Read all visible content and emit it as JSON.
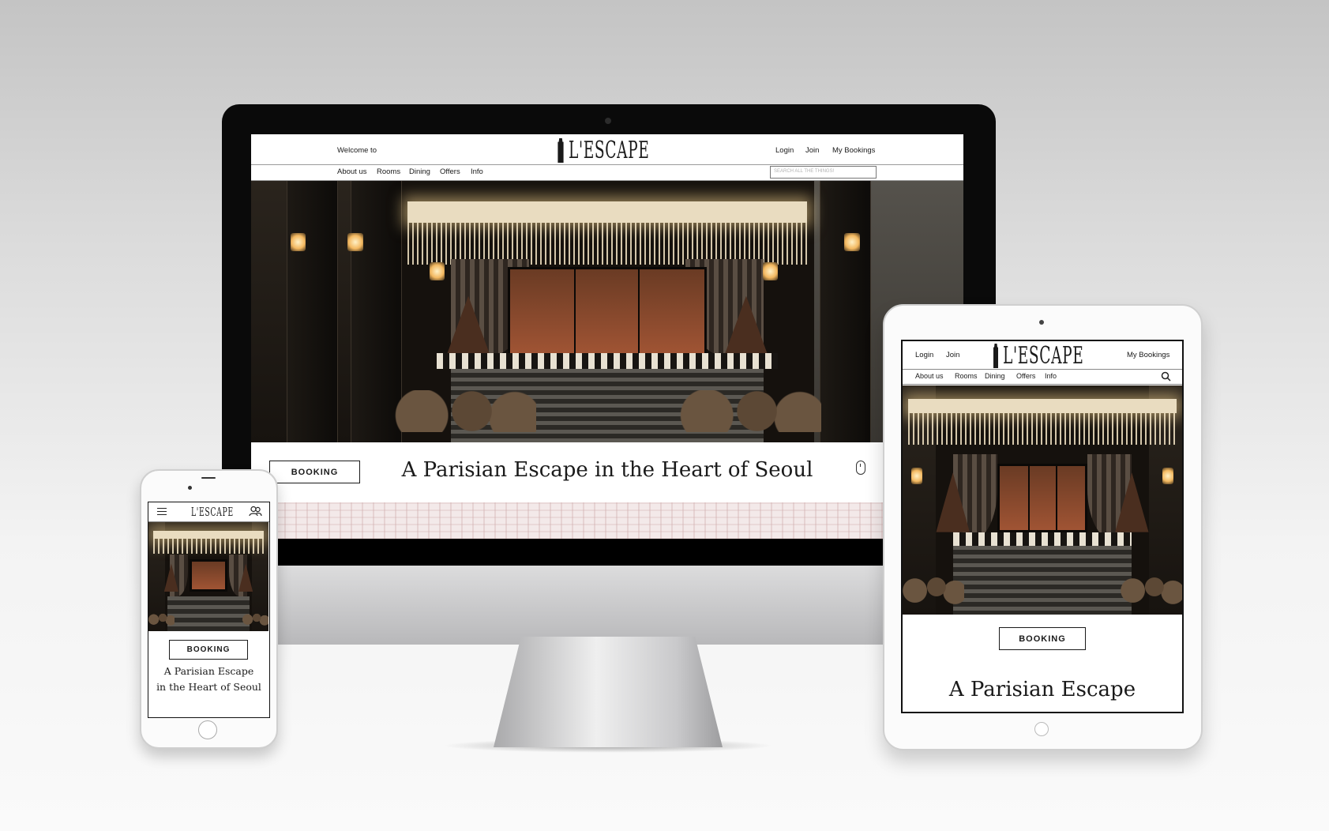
{
  "brand": {
    "logo_text": "L'ESCAPE"
  },
  "desktop": {
    "welcome_text": "Welcome to",
    "account_links": {
      "login": "Login",
      "join": "Join",
      "my_bookings": "My Bookings"
    },
    "nav": {
      "about": "About us",
      "rooms": "Rooms",
      "dining": "Dining",
      "offers": "Offers",
      "info": "Info"
    },
    "search": {
      "placeholder": "SEARCH ALL THE THINGS!"
    },
    "booking_label": "BOOKING",
    "tagline": "A Parisian Escape in the Heart of Seoul"
  },
  "tablet": {
    "account_links": {
      "login": "Login",
      "join": "Join",
      "my_bookings": "My Bookings"
    },
    "nav": {
      "about": "About us",
      "rooms": "Rooms",
      "dining": "Dining",
      "offers": "Offers",
      "info": "Info"
    },
    "booking_label": "BOOKING",
    "tagline_line1": "A Parisian Escape"
  },
  "mobile": {
    "booking_label": "BOOKING",
    "tagline_line1": "A Parisian Escape",
    "tagline_line2": "in the Heart of Seoul"
  },
  "icons": {
    "search": "search-icon",
    "scroll": "mouse-scroll-icon",
    "menu": "hamburger-menu-icon",
    "account": "people-icon",
    "logo": "tower-logo-icon"
  }
}
